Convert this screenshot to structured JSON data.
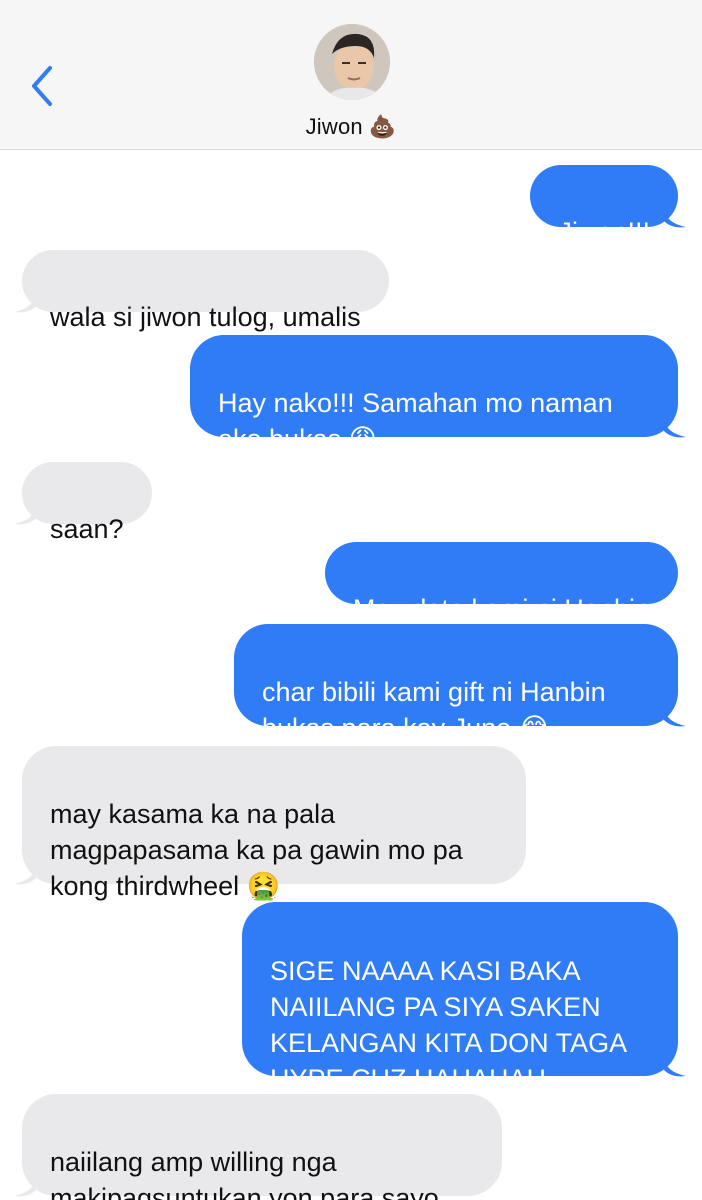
{
  "header": {
    "back_icon": "chevron-left-icon",
    "contact_name": "Jiwon",
    "contact_emoji": "💩",
    "accent_color": "#2f7cf6"
  },
  "messages": [
    {
      "from": "me",
      "text": "Jiwon!!!"
    },
    {
      "from": "them",
      "text": "wala si jiwon tulog, umalis"
    },
    {
      "from": "me",
      "text": "Hay nako!!! Samahan mo naman\nako bukas 😩"
    },
    {
      "from": "them",
      "text": "saan?"
    },
    {
      "from": "me",
      "text": "May date kami ni Hanbin"
    },
    {
      "from": "me",
      "text": "char bibili kami gift ni Hanbin\nbukas para kay June 😂"
    },
    {
      "from": "them",
      "text": "may kasama ka na pala\nmagpapasama ka pa gawin mo pa\nkong thirdwheel 🤮"
    },
    {
      "from": "me",
      "text": "SIGE NAAAA KASI BAKA\nNAIILANG PA SIYA SAKEN\nKELANGAN KITA DON TAGA\nHYPE CHZ HAHAHAH"
    },
    {
      "from": "them",
      "text": "naiilang amp willing nga\nmakipagsuntukan yon para sayo"
    }
  ],
  "colors": {
    "outgoing_bubble": "#2f7cf6",
    "incoming_bubble": "#e9e9eb",
    "header_bg": "#f6f6f6"
  }
}
